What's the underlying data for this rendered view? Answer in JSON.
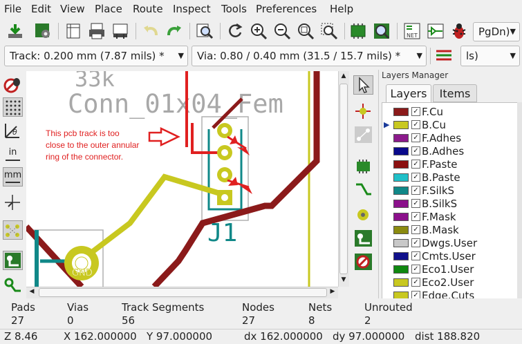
{
  "menubar": {
    "items": [
      "File",
      "Edit",
      "View",
      "Place",
      "Route",
      "Inspect",
      "Tools",
      "Preferences",
      "Help"
    ]
  },
  "toolbar": {
    "zoom_combo": "PgDn)"
  },
  "combos": {
    "track": "Track: 0.200 mm (7.87 mils) *",
    "via": "Via: 0.80 / 0.40 mm (31.5 / 15.7 mils) *",
    "units": "ls)"
  },
  "left_tools": {
    "units_in": "in",
    "units_mm": "mm"
  },
  "canvas": {
    "silk_value": "33k",
    "silk_footprint": "Conn_01x04_Fem",
    "ref": "J1",
    "pad_label": "GND",
    "annotation": "This pcb track is too close to the outer annular ring of the connector.",
    "annotation_color": "#e02020"
  },
  "layers_panel": {
    "title": "Layers Manager",
    "tabs": [
      "Layers",
      "Items"
    ],
    "active_layer": "B.Cu",
    "layers": [
      {
        "name": "F.Cu",
        "color": "#8b1a1a",
        "checked": true
      },
      {
        "name": "B.Cu",
        "color": "#c8c820",
        "checked": true
      },
      {
        "name": "F.Adhes",
        "color": "#8b1a8b",
        "checked": true
      },
      {
        "name": "B.Adhes",
        "color": "#0a0a8b",
        "checked": true
      },
      {
        "name": "F.Paste",
        "color": "#8b1010",
        "checked": true
      },
      {
        "name": "B.Paste",
        "color": "#20c0c8",
        "checked": true
      },
      {
        "name": "F.SilkS",
        "color": "#108888",
        "checked": true
      },
      {
        "name": "B.SilkS",
        "color": "#8b108b",
        "checked": true
      },
      {
        "name": "F.Mask",
        "color": "#8b108b",
        "checked": true
      },
      {
        "name": "B.Mask",
        "color": "#8b8b10",
        "checked": true
      },
      {
        "name": "Dwgs.User",
        "color": "#c8c8c8",
        "checked": true
      },
      {
        "name": "Cmts.User",
        "color": "#10108b",
        "checked": true
      },
      {
        "name": "Eco1.User",
        "color": "#108810",
        "checked": true
      },
      {
        "name": "Eco2.User",
        "color": "#c8c820",
        "checked": true
      },
      {
        "name": "Edge.Cuts",
        "color": "#c8c820",
        "checked": true
      }
    ]
  },
  "status": {
    "headers": [
      "Pads",
      "Vias",
      "Track Segments",
      "Nodes",
      "Nets",
      "Unrouted"
    ],
    "values": [
      "27",
      "0",
      "56",
      "27",
      "8",
      "2"
    ],
    "zoom": "Z 8.46",
    "x": "X 162.000000",
    "y": "Y 97.000000",
    "dx": "dx 162.000000",
    "dy": "dy 97.000000",
    "dist": "dist 188.820"
  }
}
